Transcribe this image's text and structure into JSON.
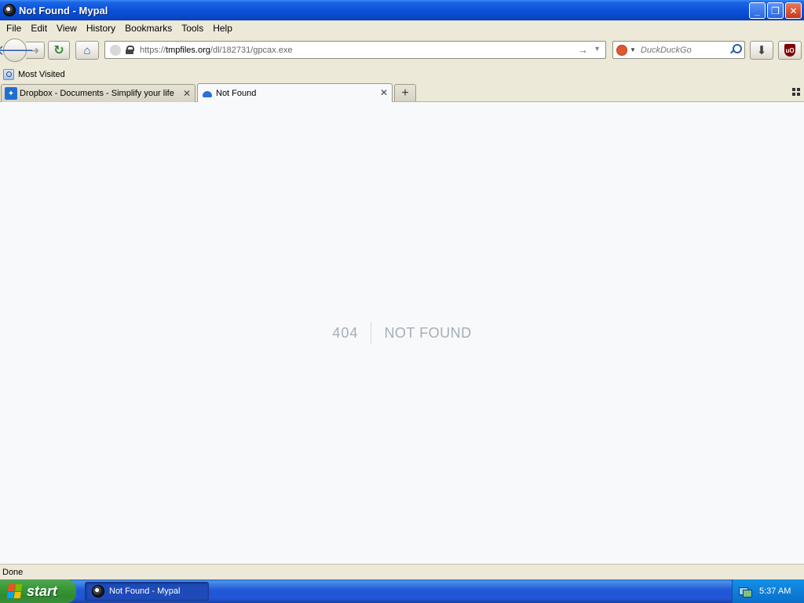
{
  "window": {
    "title": "Not Found - Mypal",
    "minimize_glyph": "_",
    "restore_glyph": "❐",
    "close_glyph": "✕"
  },
  "menu": {
    "items": [
      {
        "label": "File"
      },
      {
        "label": "Edit"
      },
      {
        "label": "View"
      },
      {
        "label": "History"
      },
      {
        "label": "Bookmarks"
      },
      {
        "label": "Tools"
      },
      {
        "label": "Help"
      }
    ]
  },
  "nav": {
    "url_prefix": "https://",
    "url_host": "tmpfiles.org",
    "url_path": "/dl/182731/gpcax.exe",
    "search_placeholder": "DuckDuckGo",
    "back_glyph": "🡐",
    "forward_glyph": "➜",
    "reload_glyph": "↻",
    "home_glyph": "⌂",
    "go_glyph": "→",
    "dropdown_glyph": "▼",
    "download_glyph": "⬇",
    "ublock_text": "uO"
  },
  "bookmarks": {
    "items": [
      {
        "label": "Most Visited"
      }
    ]
  },
  "tabs": [
    {
      "label": "Dropbox - Documents - Simplify your life",
      "active": false
    },
    {
      "label": "Not Found",
      "active": true
    }
  ],
  "tab_controls": {
    "close_glyph": "✕",
    "new_tab_glyph": "+"
  },
  "page": {
    "code": "404",
    "message": "NOT FOUND"
  },
  "status": {
    "text": "Done"
  },
  "taskbar": {
    "start_label": "start",
    "task_label": "Not Found - Mypal",
    "clock": "5:37 AM"
  },
  "colors": {
    "titlebar": "#0a52d8",
    "content_bg": "#f7f9fb",
    "notfound_text": "#a6aeb6",
    "start_green": "#3c9c3c"
  }
}
